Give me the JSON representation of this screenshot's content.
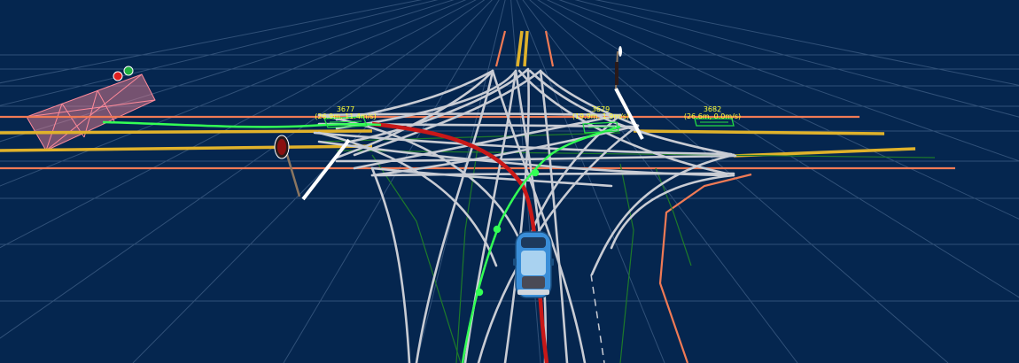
{
  "scene": {
    "background_color": "#05264f",
    "grid_color": "#3f5f86",
    "colors": {
      "lane_boundary_yellow": "#e0b22b",
      "road_edge_orange": "#f07a55",
      "junction_lane_gray": "#c9ccd4",
      "planning_trajectory_green": "#33ff55",
      "reference_line_darkgreen": "#1d7a2a",
      "ego_routing_red": "#c81818",
      "obstacle_box_green": "#22dd44",
      "obstacle_label_yellow": "#ffff33",
      "stop_line_white": "#ffffff",
      "crosswalk_pink": "#ff8a9a",
      "ego_vehicle_blue": "#3a8ed8"
    }
  },
  "obstacles": [
    {
      "id": "3677",
      "info": "(26.9m, 11.4m/s)"
    },
    {
      "id": "3679",
      "info": "(19.9m, 1.9m/s)"
    },
    {
      "id": "3682",
      "info": "(26.6m, 0.0m/s)"
    }
  ],
  "traffic_signals": [
    {
      "name": "signal-left",
      "state": "red"
    },
    {
      "name": "signal-right",
      "state": "red"
    }
  ],
  "crosswalk_signal": {
    "states": [
      "red",
      "green"
    ]
  },
  "ego_vehicle": {
    "icon": "car-icon",
    "color": "#3a8ed8"
  }
}
